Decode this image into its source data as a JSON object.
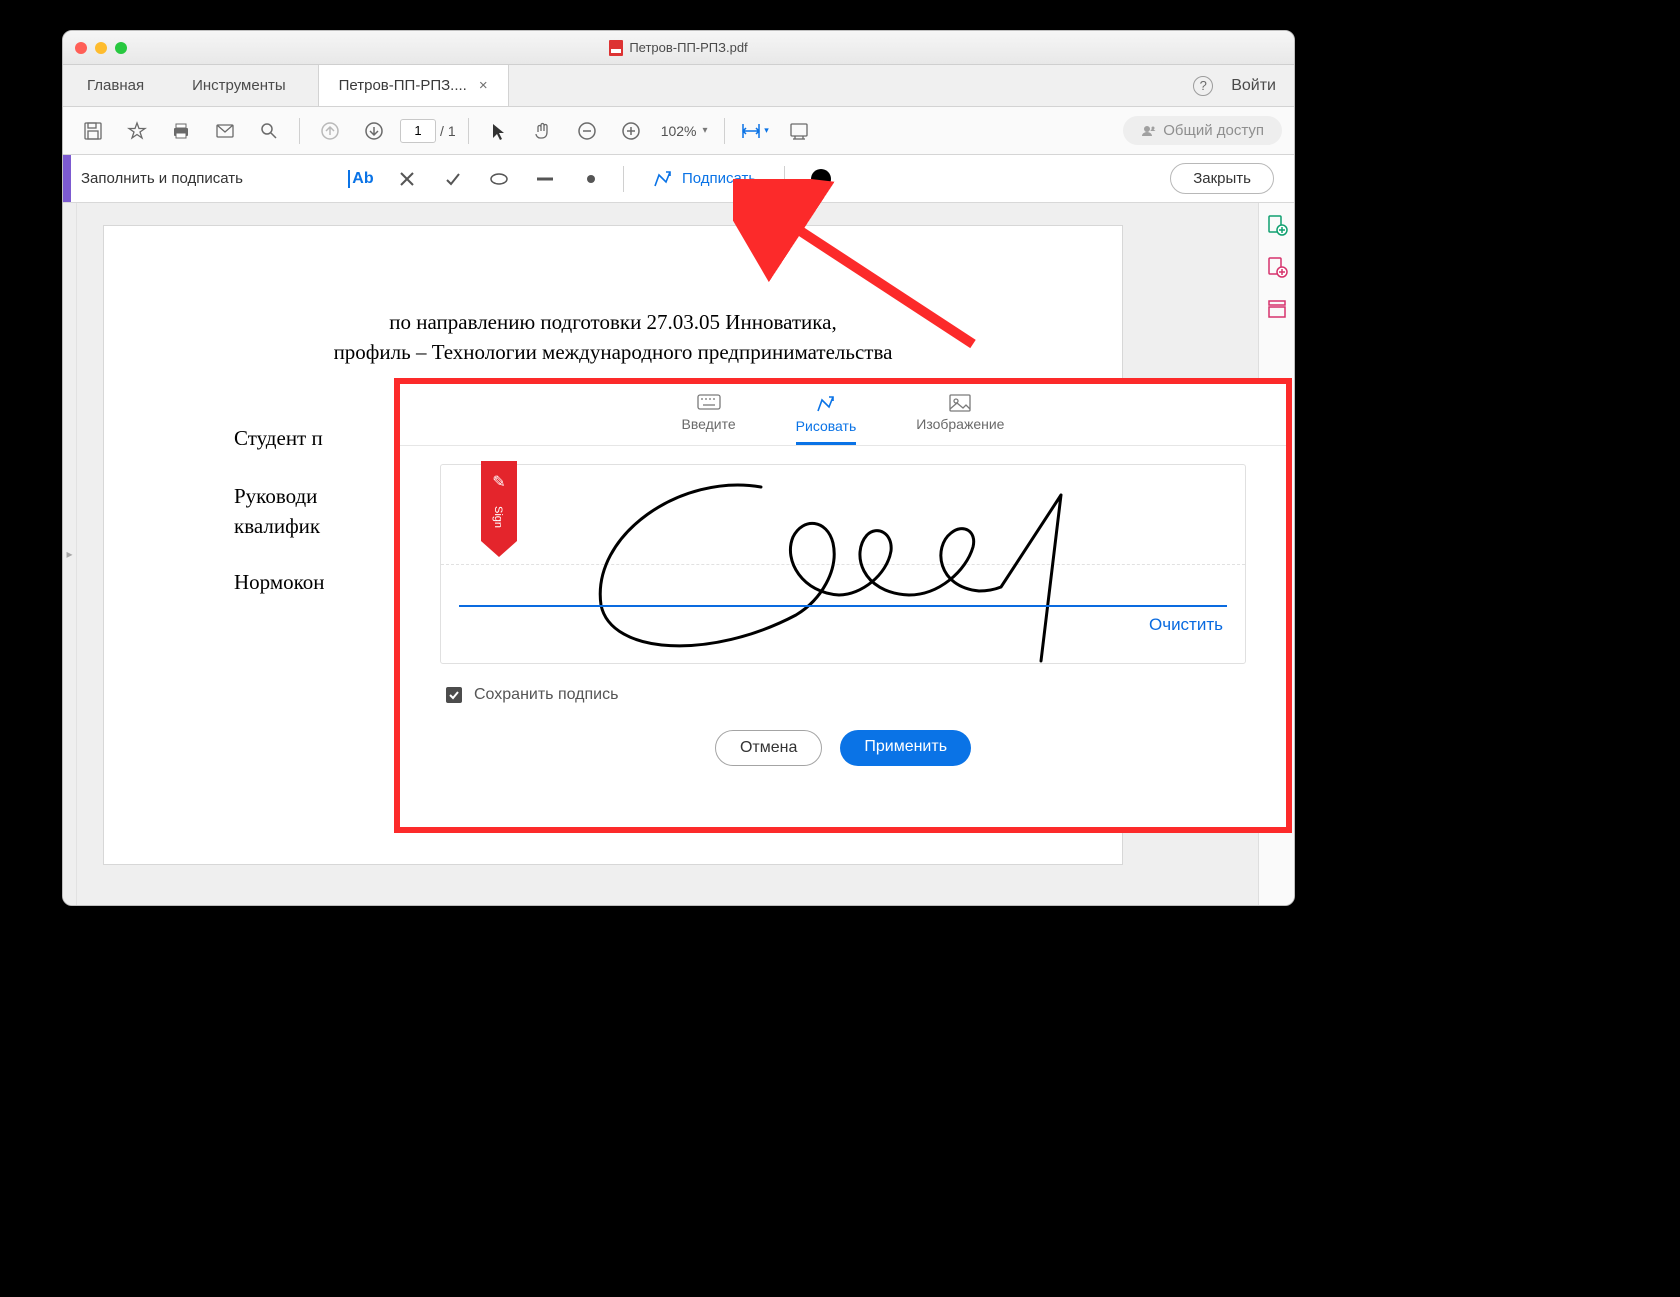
{
  "window": {
    "filename": "Петров-ПП-РПЗ.pdf"
  },
  "nav": {
    "home": "Главная",
    "tools": "Инструменты",
    "login": "Войти"
  },
  "tab": {
    "label": "Петров-ПП-РПЗ...."
  },
  "toolbar": {
    "page_current": "1",
    "page_sep": "/",
    "page_total": "1",
    "zoom": "102%",
    "share_label": "Общий доступ"
  },
  "fillsign": {
    "title": "Заполнить и подписать",
    "sign_label": "Подписать",
    "close_label": "Закрыть"
  },
  "document": {
    "line1": "по направлению подготовки 27.03.05 Инноватика,",
    "line2": "профиль – Технологии международного предпринимательства",
    "student": "Студент п",
    "supervisor1": "Руководи",
    "supervisor2": "квалифик",
    "norm": "Нормокон"
  },
  "dialog": {
    "tab_type": "Введите",
    "tab_draw": "Рисовать",
    "tab_image": "Изображение",
    "clear": "Очистить",
    "ribbon_label": "Sign",
    "save_signature": "Сохранить подпись",
    "cancel": "Отмена",
    "apply": "Применить"
  }
}
